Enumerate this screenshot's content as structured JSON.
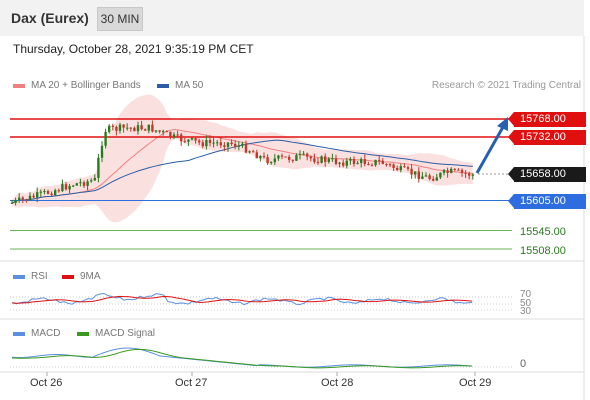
{
  "header": {
    "title": "Dax (Eurex)",
    "interval": "30 MIN"
  },
  "timestamp": "Thursday, October 28, 2021 9:35:19 PM CET",
  "legend": {
    "ma20": {
      "label": "MA 20 + Bollinger Bands",
      "color": "#f08080"
    },
    "ma50": {
      "label": "MA 50",
      "color": "#2b5ea7"
    },
    "credit": "Research © 2021 Trading Central"
  },
  "levels": {
    "r2": {
      "label": "15768.00",
      "value": 15768,
      "color": "#e01010"
    },
    "r1": {
      "label": "15732.00",
      "value": 15732,
      "color": "#e01010"
    },
    "last": {
      "label": "15658.00",
      "value": 15658,
      "color": "#1a1a1a"
    },
    "pivot": {
      "label": "15605.00",
      "value": 15605,
      "color": "#2e6ddf"
    },
    "s1": {
      "label": "15545.00",
      "value": 15545,
      "color": "#2a7a1f"
    },
    "s2": {
      "label": "15508.00",
      "value": 15508,
      "color": "#2a7a1f"
    }
  },
  "rsi": {
    "label": "RSI",
    "color": "#5b8fe0",
    "signal_label": "9MA",
    "signal_color": "#e01010",
    "levels": [
      "70",
      "50",
      "30"
    ]
  },
  "macd": {
    "label": "MACD",
    "color": "#5b8fe0",
    "signal_label": "MACD Signal",
    "signal_color": "#3a9a1f",
    "zero_label": "0"
  },
  "dates": [
    "Oct 26",
    "Oct 27",
    "Oct 28",
    "Oct 29"
  ],
  "colors": {
    "up": "#2a7a1f",
    "down": "#c0392b",
    "arrow": "#2660b0"
  }
}
